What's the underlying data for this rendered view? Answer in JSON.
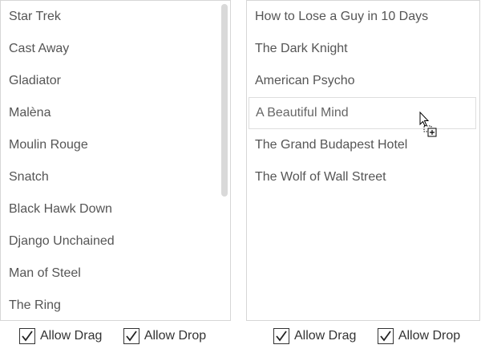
{
  "left_list": {
    "items": [
      "Star Trek",
      "Cast Away",
      "Gladiator",
      "Malèna",
      "Moulin Rouge",
      "Snatch",
      "Black Hawk Down",
      "Django Unchained",
      "Man of Steel",
      "The Ring"
    ],
    "allow_drag_label": "Allow Drag",
    "allow_drop_label": "Allow Drop",
    "allow_drag_checked": true,
    "allow_drop_checked": true
  },
  "right_list": {
    "items": [
      "How to Lose a Guy in 10 Days",
      "The Dark Knight",
      "American Psycho",
      "A Beautiful Mind",
      "The Grand Budapest Hotel",
      "The Wolf of Wall Street"
    ],
    "allow_drag_label": "Allow Drag",
    "allow_drop_label": "Allow Drop",
    "allow_drag_checked": true,
    "allow_drop_checked": true
  },
  "cursor": {
    "icon": "drag-copy-cursor-icon"
  }
}
